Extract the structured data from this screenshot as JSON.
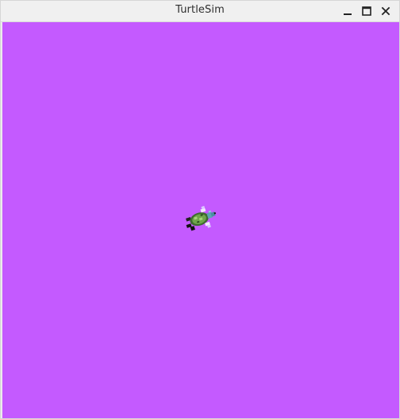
{
  "window": {
    "title": "TurtleSim",
    "controls": [
      {
        "name": "minimize",
        "icon": "minimize-icon"
      },
      {
        "name": "maximize",
        "icon": "maximize-icon"
      },
      {
        "name": "close",
        "icon": "close-icon"
      }
    ]
  },
  "canvas": {
    "background_color": "#c45aff"
  },
  "turtle": {
    "icon": "turtle-icon"
  }
}
